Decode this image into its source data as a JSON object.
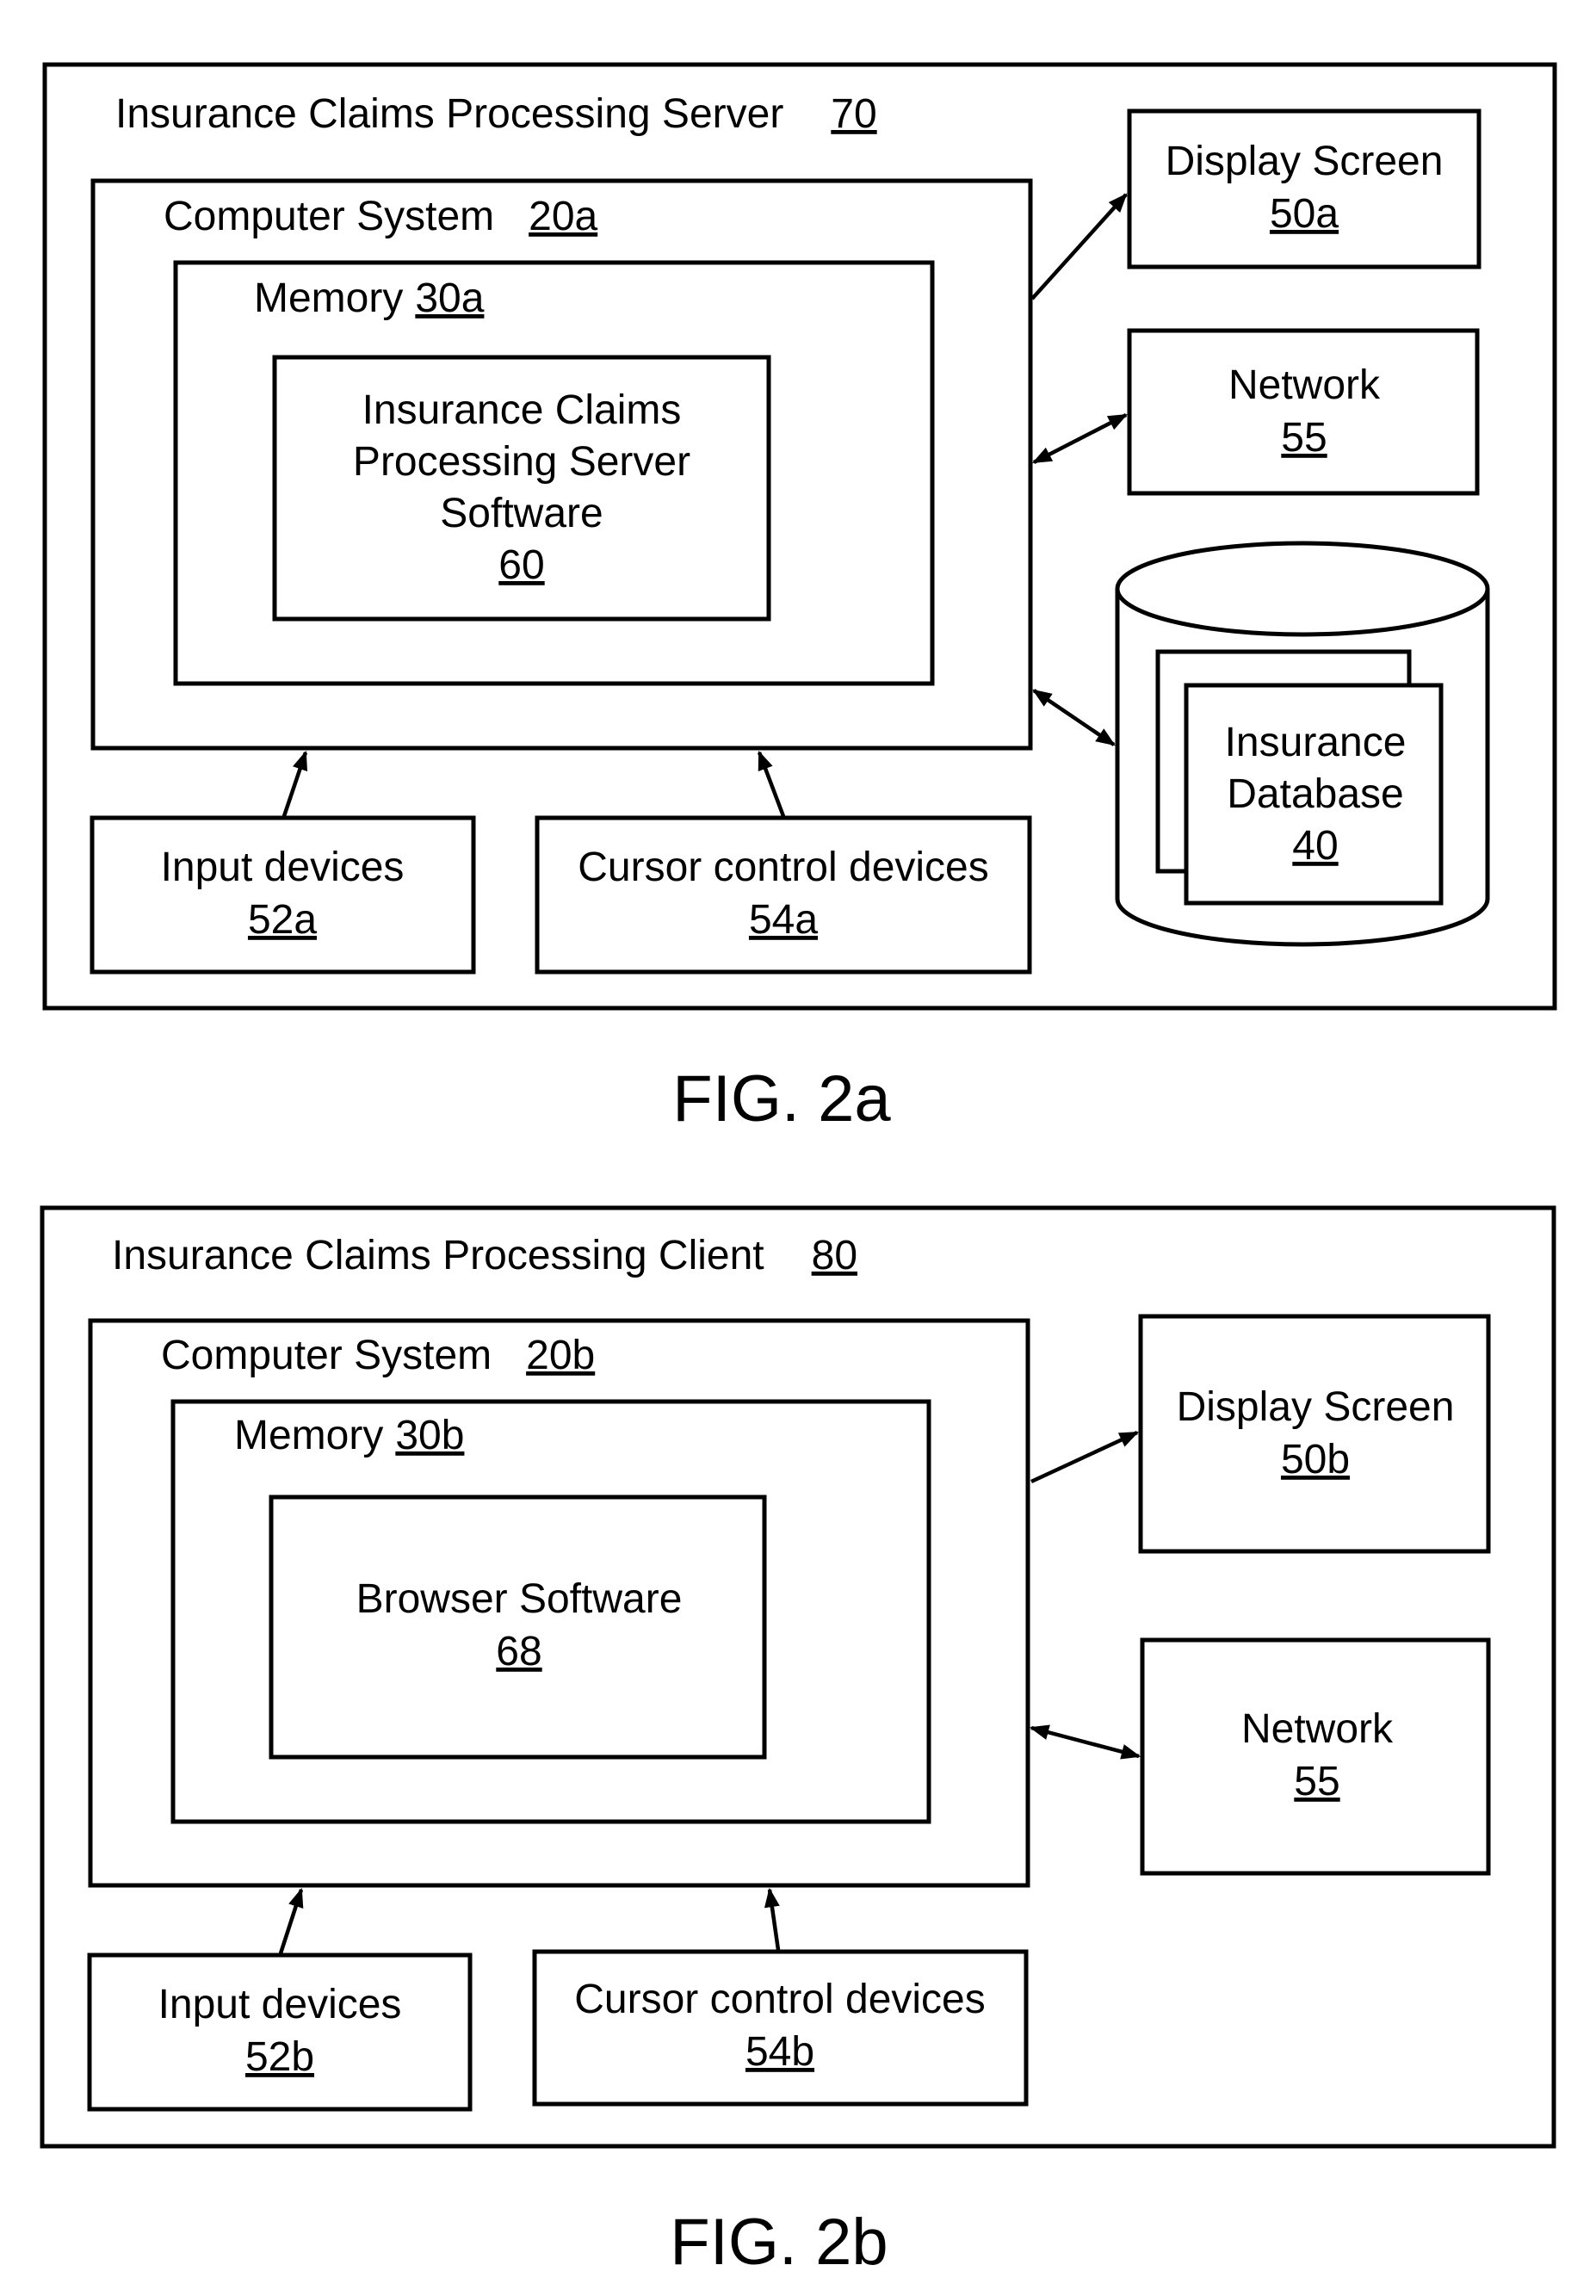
{
  "fig_a": {
    "caption": "FIG. 2a",
    "server": {
      "label": "Insurance Claims Processing Server",
      "ref": "70"
    },
    "computer_system": {
      "label": "Computer System",
      "ref": "20a"
    },
    "memory": {
      "label": "Memory",
      "ref": "30a"
    },
    "software": {
      "lines": [
        "Insurance Claims",
        "Processing Server",
        "Software"
      ],
      "ref": "60"
    },
    "display": {
      "label": "Display Screen",
      "ref": "50a"
    },
    "network": {
      "label": "Network",
      "ref": "55"
    },
    "database": {
      "lines": [
        "Insurance",
        "Database"
      ],
      "ref": "40"
    },
    "input": {
      "label": "Input devices",
      "ref": "52a"
    },
    "cursor": {
      "label": "Cursor control devices",
      "ref": "54a"
    }
  },
  "fig_b": {
    "caption": "FIG. 2b",
    "client": {
      "label": "Insurance Claims Processing Client",
      "ref": "80"
    },
    "computer_system": {
      "label": "Computer System",
      "ref": "20b"
    },
    "memory": {
      "label": "Memory",
      "ref": "30b"
    },
    "software": {
      "lines": [
        "Browser Software"
      ],
      "ref": "68"
    },
    "display": {
      "label": "Display Screen",
      "ref": "50b"
    },
    "network": {
      "label": "Network",
      "ref": "55"
    },
    "input": {
      "label": "Input devices",
      "ref": "52b"
    },
    "cursor": {
      "label": "Cursor control devices",
      "ref": "54b"
    }
  }
}
